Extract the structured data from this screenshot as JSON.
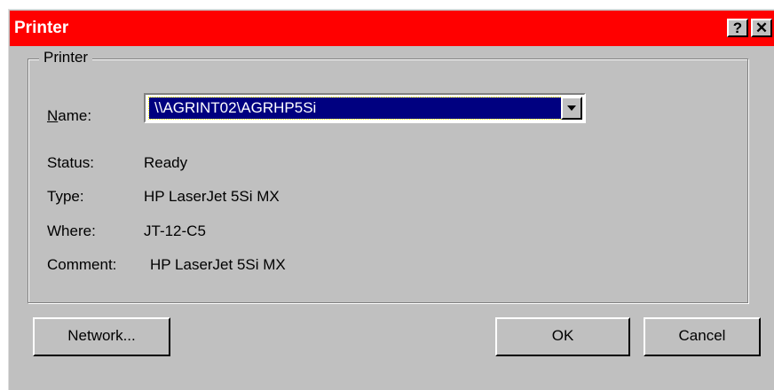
{
  "window": {
    "title": "Printer",
    "help_label": "?",
    "close_label": "✕"
  },
  "group": {
    "label": "Printer"
  },
  "fields": {
    "name_label_mnemonic": "N",
    "name_label_rest": "ame:",
    "name_value": "\\\\AGRINT02\\AGRHP5Si",
    "status_label": "Status:",
    "status_value": "Ready",
    "type_label": "Type:",
    "type_value": "HP LaserJet 5Si MX",
    "where_label": "Where:",
    "where_value": "JT-12-C5",
    "comment_label": "Comment:",
    "comment_value": "HP LaserJet 5Si MX"
  },
  "buttons": {
    "network": "Network...",
    "ok": "OK",
    "cancel": "Cancel"
  },
  "colors": {
    "titlebar": "#ff0000",
    "face": "#c0c0c0",
    "selection": "#000080"
  },
  "icons": {
    "close": "close-icon",
    "help": "help-icon",
    "dropdown": "chevron-down-icon"
  }
}
